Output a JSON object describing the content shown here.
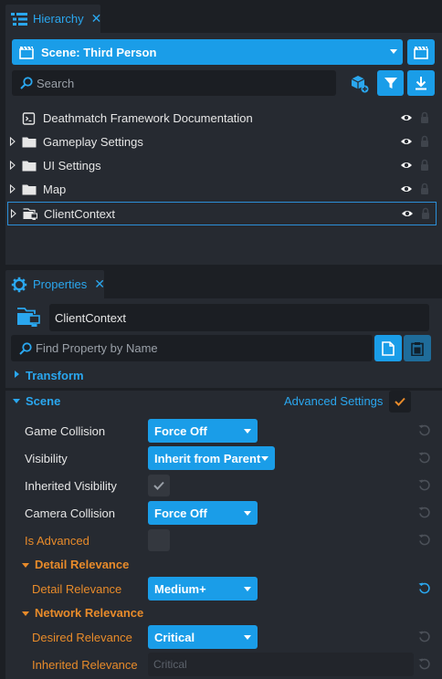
{
  "hierarchy": {
    "tab_label": "Hierarchy",
    "scene_selector": "Scene: Third Person",
    "search_placeholder": "Search",
    "items": [
      {
        "name": "Deathmatch Framework Documentation",
        "icon": "script-icon",
        "expandable": false,
        "selected": false
      },
      {
        "name": "Gameplay Settings",
        "icon": "folder-icon",
        "expandable": true,
        "selected": false
      },
      {
        "name": "UI Settings",
        "icon": "folder-icon",
        "expandable": true,
        "selected": false
      },
      {
        "name": "Map",
        "icon": "folder-icon",
        "expandable": true,
        "selected": false
      },
      {
        "name": "ClientContext",
        "icon": "client-context-icon",
        "expandable": true,
        "selected": true
      }
    ]
  },
  "properties": {
    "tab_label": "Properties",
    "object_name": "ClientContext",
    "find_placeholder": "Find Property by Name",
    "transform_label": "Transform",
    "scene_label": "Scene",
    "advanced_settings_label": "Advanced Settings",
    "advanced_settings_checked": true,
    "rows": {
      "game_collision": {
        "label": "Game Collision",
        "value": "Force Off"
      },
      "visibility": {
        "label": "Visibility",
        "value": "Inherit from Parent"
      },
      "inherited_visibility": {
        "label": "Inherited Visibility",
        "checked": true
      },
      "camera_collision": {
        "label": "Camera Collision",
        "value": "Force Off"
      },
      "is_advanced": {
        "label": "Is Advanced",
        "checked": false
      }
    },
    "detail_relevance_section": "Detail Relevance",
    "detail_relevance": {
      "label": "Detail Relevance",
      "value": "Medium+"
    },
    "network_relevance_section": "Network Relevance",
    "desired_relevance": {
      "label": "Desired Relevance",
      "value": "Critical"
    },
    "inherited_relevance": {
      "label": "Inherited Relevance",
      "value": "Critical"
    }
  },
  "colors": {
    "accent": "#1a9de8",
    "accent_text": "#2aa7ef",
    "orange": "#e88b2a",
    "panel_bg": "#262a31",
    "app_bg": "#1c1f24"
  }
}
